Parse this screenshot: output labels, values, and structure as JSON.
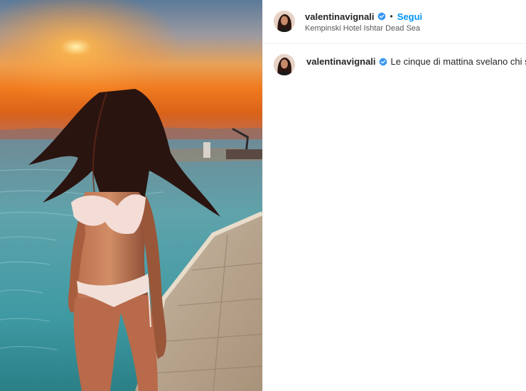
{
  "post": {
    "username": "valentinavignali",
    "verified": true,
    "separator": "•",
    "follow_label": "Segui",
    "location": "Kempinski Hotel Ishtar Dead Sea",
    "caption": {
      "username": "valentinavignali",
      "text": "Le cinque di mattina svelano chi sei"
    }
  },
  "colors": {
    "accent": "#0095f6",
    "verified_badge": "#3897f0",
    "text_primary": "#262626",
    "text_secondary": "#595959"
  },
  "icons": {
    "verified": "verified-badge-icon"
  }
}
